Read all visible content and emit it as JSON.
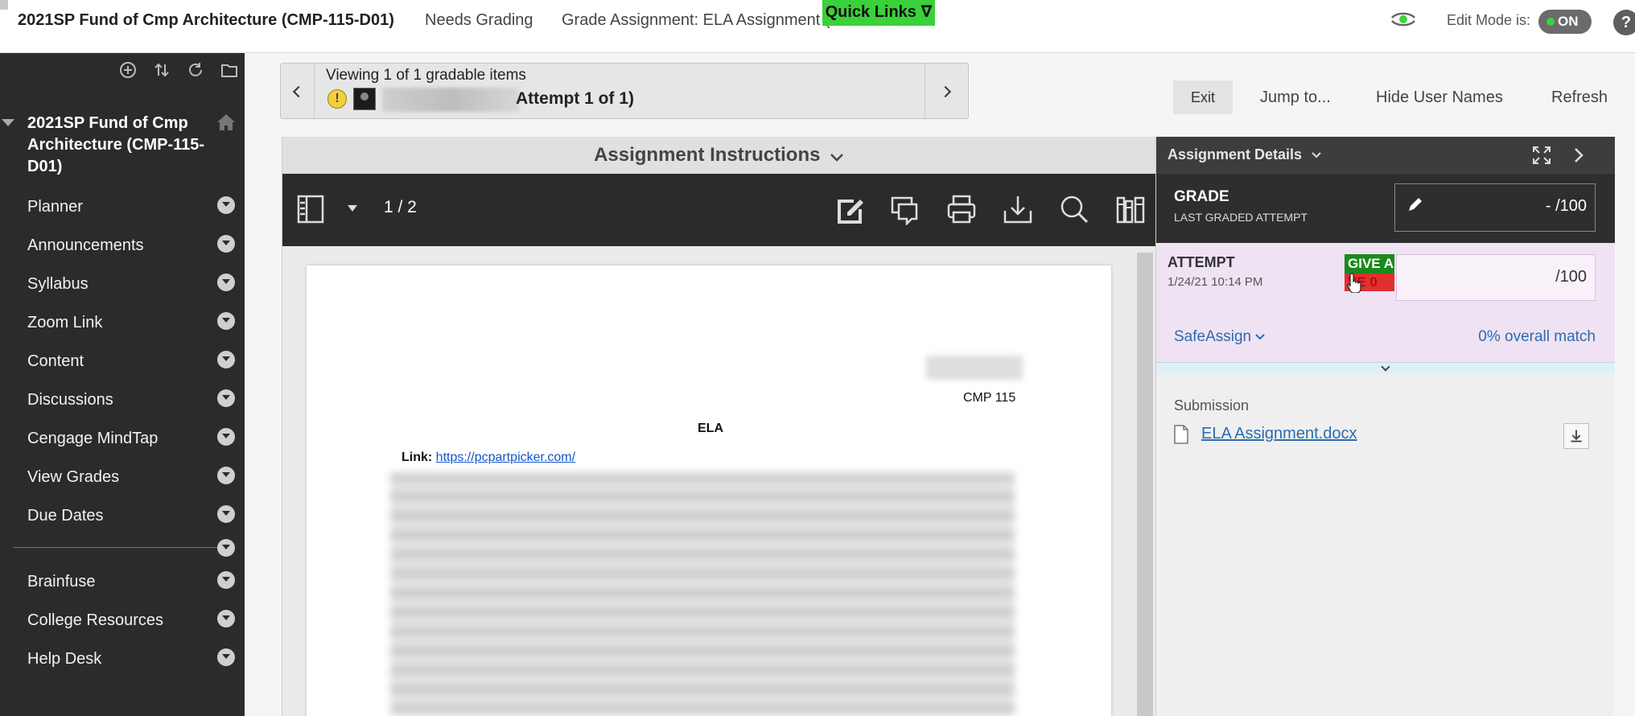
{
  "topbar": {
    "course_crumb": "2021SP Fund of Cmp Architecture (CMP-115-D01)",
    "needs_grading": "Needs Grading",
    "grade_assignment": "Grade Assignment: ELA Assignment (",
    "quick_links": "Quick Links ∇",
    "edit_mode_label": "Edit Mode is:",
    "edit_mode_value": "ON",
    "help": "?"
  },
  "sidebar": {
    "course_title": "2021SP Fund of Cmp Architecture (CMP-115-D01)",
    "items": [
      {
        "label": "Planner"
      },
      {
        "label": "Announcements"
      },
      {
        "label": "Syllabus"
      },
      {
        "label": "Zoom Link"
      },
      {
        "label": "Content"
      },
      {
        "label": "Discussions"
      },
      {
        "label": "Cengage MindTap"
      },
      {
        "label": "View Grades"
      },
      {
        "label": "Due Dates"
      }
    ],
    "extra_items": [
      {
        "label": "Brainfuse"
      },
      {
        "label": "College Resources"
      },
      {
        "label": "Help Desk"
      }
    ]
  },
  "viewer": {
    "viewing_text": "Viewing 1 of 1 gradable items",
    "attempt_text": "Attempt 1 of 1)"
  },
  "toolbar": {
    "exit": "Exit",
    "jump_to": "Jump to...",
    "hide_user_names": "Hide User Names",
    "refresh": "Refresh"
  },
  "document": {
    "header": "Assignment Instructions",
    "page_count": "1 / 2",
    "course": "CMP 115",
    "title": "ELA",
    "link_label": "Link:",
    "link_url": "https://pcpartpicker.com/"
  },
  "details": {
    "title": "Assignment Details",
    "grade_label": "GRADE",
    "grade_sub": "LAST GRADED ATTEMPT",
    "grade_value": "-",
    "grade_max": "/100",
    "attempt_label": "ATTEMPT",
    "attempt_date": "1/24/21 10:14 PM",
    "give_a": "GIVE A",
    "give_b": "VE 0",
    "attempt_max": "/100",
    "safeassign": "SafeAssign",
    "overall_match": "0% overall match",
    "submission_label": "Submission",
    "file_name": "ELA Assignment.docx"
  },
  "colors": {
    "sidebar_bg": "#2b2b2b",
    "quick_links": "#3ad13a",
    "link_blue": "#2b6cb0",
    "attempt_bg": "#efe2f3"
  }
}
